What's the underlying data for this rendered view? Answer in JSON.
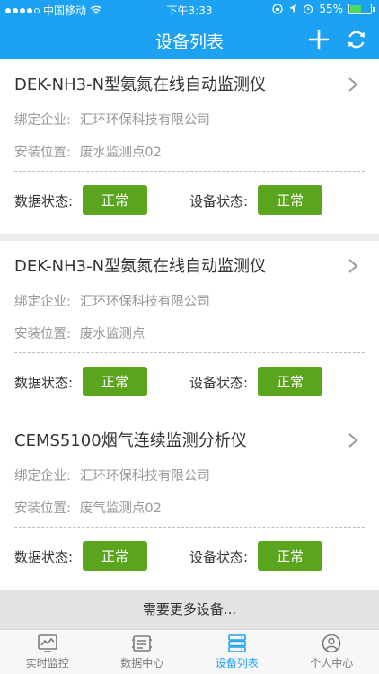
{
  "statusbar": {
    "carrier": "中国移动",
    "time": "下午3:33",
    "battery": "55%",
    "battery_level": 0.55
  },
  "header": {
    "title": "设备列表"
  },
  "devices": [
    {
      "name": "DEK-NH3-N型氨氮在线自动监测仪",
      "company_label": "绑定企业:",
      "company": "汇环环保科技有限公司",
      "location_label": "安装位置:",
      "location": "废水监测点02",
      "data_status_label": "数据状态:",
      "data_status": "正常",
      "device_status_label": "设备状态:",
      "device_status": "正常"
    },
    {
      "name": "DEK-NH3-N型氨氮在线自动监测仪",
      "company_label": "绑定企业:",
      "company": "汇环环保科技有限公司",
      "location_label": "安装位置:",
      "location": "废水监测点",
      "data_status_label": "数据状态:",
      "data_status": "正常",
      "device_status_label": "设备状态:",
      "device_status": "正常"
    },
    {
      "name": "CEMS5100烟气连续监测分析仪",
      "company_label": "绑定企业:",
      "company": "汇环环保科技有限公司",
      "location_label": "安装位置:",
      "location": "废气监测点02",
      "data_status_label": "数据状态:",
      "data_status": "正常",
      "device_status_label": "设备状态:",
      "device_status": "正常"
    }
  ],
  "more_label": "需要更多设备...",
  "tabs": [
    {
      "label": "实时监控",
      "icon": "monitor-chart-icon"
    },
    {
      "label": "数据中心",
      "icon": "data-center-icon"
    },
    {
      "label": "设备列表",
      "icon": "server-list-icon"
    },
    {
      "label": "个人中心",
      "icon": "user-icon"
    }
  ],
  "colors": {
    "header": "#1da1f2",
    "status_ok": "#5ba41e",
    "active_tab": "#1da1f2"
  }
}
